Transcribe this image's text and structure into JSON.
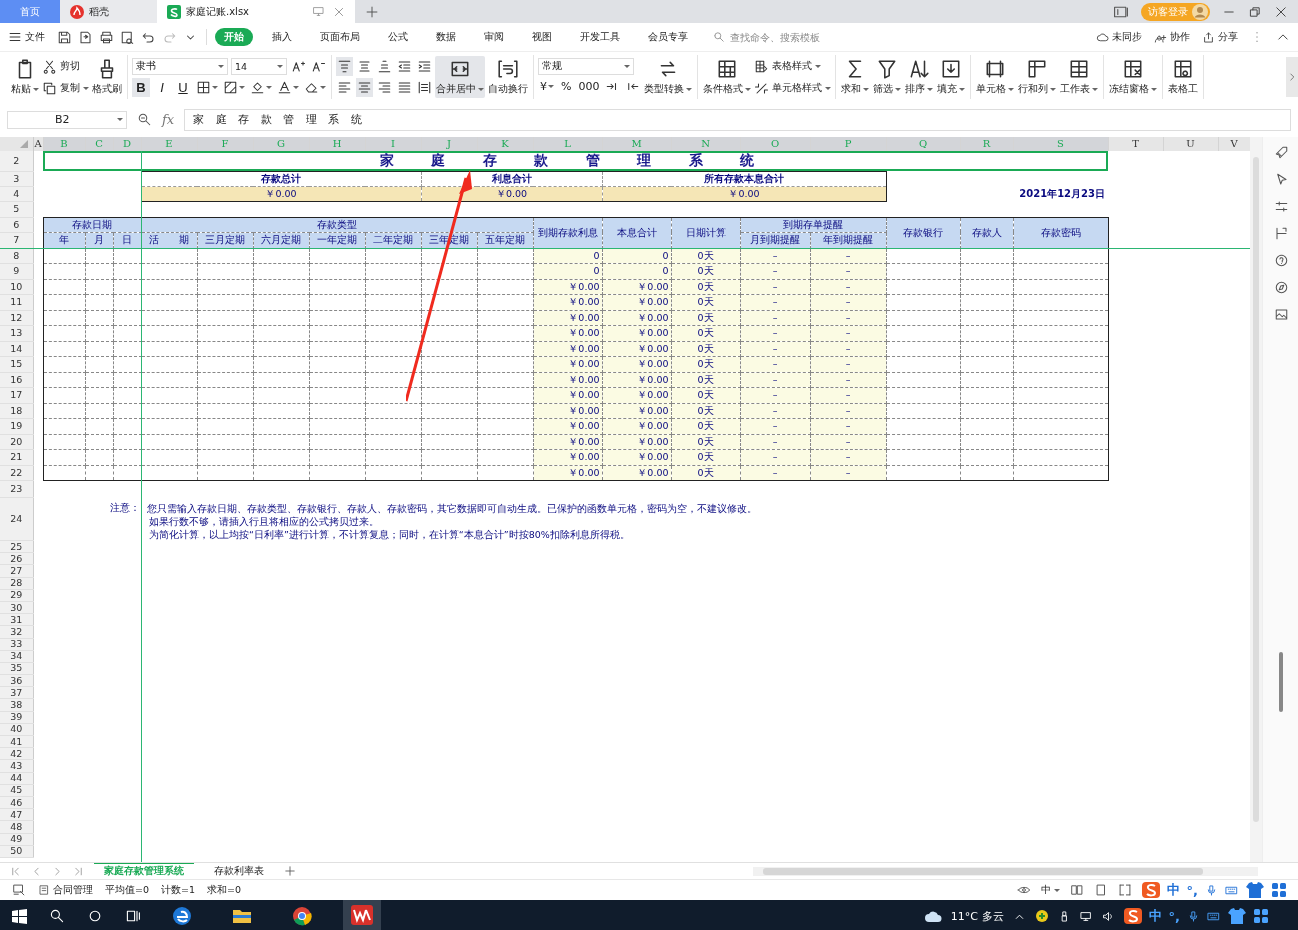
{
  "app_tabs": [
    {
      "label": "首页",
      "kind": "home",
      "selected": false
    },
    {
      "label": "稻壳",
      "kind": "docer",
      "selected": false
    },
    {
      "label": "家庭记账.xlsx",
      "kind": "file",
      "selected": true
    }
  ],
  "login": "访客登录",
  "menu": {
    "file": "文件",
    "tabs": [
      {
        "label": "开始",
        "selected": true
      },
      {
        "label": "插入",
        "selected": false
      },
      {
        "label": "页面布局",
        "selected": false
      },
      {
        "label": "公式",
        "selected": false
      },
      {
        "label": "数据",
        "selected": false
      },
      {
        "label": "审阅",
        "selected": false
      },
      {
        "label": "视图",
        "selected": false
      },
      {
        "label": "开发工具",
        "selected": false
      },
      {
        "label": "会员专享",
        "selected": false
      }
    ],
    "search": {
      "placeholder": "查找命令、搜索模板"
    },
    "actions": [
      "未同步",
      "协作",
      "分享"
    ]
  },
  "ribbon": [
    [
      {
        "kind": "large",
        "label": "粘贴",
        "dropdown": true
      },
      {
        "kind": "stack",
        "rows": [
          [
            {
              "kind": "small",
              "label": "剪切",
              "dropdown": false
            }
          ],
          [
            {
              "kind": "small",
              "label": "复制",
              "dropdown": true
            }
          ]
        ]
      },
      {
        "kind": "large",
        "label": "格式刷",
        "dropdown": false
      }
    ],
    [
      {
        "kind": "stack",
        "rows": [
          [
            {
              "kind": "field",
              "value": "隶书"
            },
            {
              "kind": "field",
              "value": "14"
            },
            {
              "kind": "icon",
              "selected": false,
              "dropdown": false
            },
            {
              "kind": "icon",
              "selected": false,
              "dropdown": false
            }
          ],
          [
            {
              "kind": "toggle",
              "label": "B",
              "selected": true
            },
            {
              "kind": "toggle",
              "label": "I",
              "selected": false
            },
            {
              "kind": "toggle",
              "label": "U",
              "selected": false
            },
            {
              "kind": "icon",
              "selected": false,
              "dropdown": true
            },
            {
              "kind": "icon",
              "selected": false,
              "dropdown": true
            },
            {
              "kind": "icon",
              "selected": false,
              "dropdown": true
            },
            {
              "kind": "icon",
              "selected": false,
              "dropdown": true
            },
            {
              "kind": "icon",
              "selected": false,
              "dropdown": true
            }
          ]
        ]
      }
    ],
    [
      {
        "kind": "stack",
        "rows": [
          [
            {
              "kind": "icon",
              "selected": true,
              "dropdown": false
            },
            {
              "kind": "icon",
              "selected": false,
              "dropdown": false
            },
            {
              "kind": "icon",
              "selected": false,
              "dropdown": false
            },
            {
              "kind": "icon",
              "selected": false,
              "dropdown": false
            },
            {
              "kind": "icon",
              "selected": false,
              "dropdown": false
            }
          ],
          [
            {
              "kind": "icon",
              "selected": false,
              "dropdown": false
            },
            {
              "kind": "icon",
              "selected": true,
              "dropdown": false
            },
            {
              "kind": "icon",
              "selected": false,
              "dropdown": false
            },
            {
              "kind": "icon",
              "selected": false,
              "dropdown": false
            },
            {
              "kind": "icon",
              "selected": false,
              "dropdown": false
            }
          ]
        ]
      },
      {
        "kind": "large",
        "label": "合并居中",
        "dropdown": true,
        "selected": true
      },
      {
        "kind": "large",
        "label": "自动换行",
        "dropdown": false,
        "selected": false
      }
    ],
    [
      {
        "kind": "stack",
        "rows": [
          [
            {
              "kind": "field",
              "value": "常规"
            }
          ],
          [
            {
              "kind": "glyph",
              "label": "¥",
              "dropdown": true
            },
            {
              "kind": "glyph",
              "label": "%",
              "dropdown": false
            },
            {
              "kind": "glyph",
              "label": "000",
              "dropdown": false
            },
            {
              "kind": "icon",
              "selected": false,
              "dropdown": false
            },
            {
              "kind": "icon",
              "selected": false,
              "dropdown": false
            }
          ]
        ]
      },
      {
        "kind": "large",
        "label": "类型转换",
        "dropdown": true
      }
    ],
    [
      {
        "kind": "large",
        "label": "条件格式",
        "dropdown": true
      },
      {
        "kind": "stack",
        "rows": [
          [
            {
              "kind": "small",
              "label": "表格样式",
              "dropdown": true
            }
          ],
          [
            {
              "kind": "small",
              "label": "单元格样式",
              "dropdown": true
            }
          ]
        ]
      }
    ],
    [
      {
        "kind": "large",
        "label": "求和",
        "dropdown": true
      },
      {
        "kind": "large",
        "label": "筛选",
        "dropdown": true
      },
      {
        "kind": "large",
        "label": "排序",
        "dropdown": true
      },
      {
        "kind": "large",
        "label": "填充",
        "dropdown": true
      }
    ],
    [
      {
        "kind": "large",
        "label": "单元格",
        "dropdown": true
      },
      {
        "kind": "large",
        "label": "行和列",
        "dropdown": true
      },
      {
        "kind": "large",
        "label": "工作表",
        "dropdown": true
      }
    ],
    [
      {
        "kind": "large",
        "label": "冻结窗格",
        "dropdown": true
      }
    ],
    [
      {
        "kind": "large",
        "label": "表格工",
        "dropdown": false
      }
    ]
  ],
  "formula_bar": {
    "name_box": "B2",
    "fx": "fx",
    "formula": "家 庭 存 款 管 理 系 统"
  },
  "sheet": {
    "column_headers": [
      "A",
      "B",
      "C",
      "D",
      "E",
      "F",
      "G",
      "H",
      "I",
      "J",
      "K",
      "L",
      "M",
      "N",
      "O",
      "P",
      "Q",
      "R",
      "S",
      "T",
      "U",
      "V"
    ],
    "row_numbers": [
      "2",
      "3",
      "4",
      "5",
      "6",
      "7",
      "8",
      "9",
      "10",
      "11",
      "12",
      "13",
      "14",
      "15",
      "16",
      "17",
      "18",
      "19",
      "20",
      "21",
      "22",
      "23",
      "24",
      "25",
      "26",
      "27",
      "28",
      "29",
      "30",
      "31",
      "32",
      "33",
      "34",
      "35",
      "36",
      "37",
      "38",
      "39",
      "40",
      "41",
      "42",
      "43",
      "44",
      "45",
      "46",
      "47",
      "48",
      "49",
      "50"
    ],
    "title": "家 庭 存 款 管 理 系 统",
    "summary": [
      {
        "label": "存款总计",
        "value": "￥0.00"
      },
      {
        "label": "利息合计",
        "value": "￥0.00"
      },
      {
        "label": "所有存款本息合计",
        "value": "￥0.00"
      }
    ],
    "date": "2021年12月23日",
    "date_header": {
      "label": "存款日期",
      "sub": [
        "年",
        "月",
        "日"
      ]
    },
    "type_header": {
      "label": "存款类型",
      "sub": [
        "活　　期",
        "三月定期",
        "六月定期",
        "一年定期",
        "二年定期",
        "三年定期",
        "五年定期"
      ]
    },
    "single_headers": [
      "到期存款利息",
      "本息合计",
      "日期计算"
    ],
    "reminder_header": {
      "label": "到期存单提醒",
      "sub": [
        "月到期提醒",
        "年到期提醒"
      ]
    },
    "tail_headers": [
      "存款银行",
      "存款人",
      "存款密码"
    ],
    "data_rows": [
      [
        "0",
        "0",
        "0天",
        "–",
        "–"
      ],
      [
        "0",
        "0",
        "0天",
        "–",
        "–"
      ],
      [
        "￥0.00",
        "￥0.00",
        "0天",
        "–",
        "–"
      ],
      [
        "￥0.00",
        "￥0.00",
        "0天",
        "–",
        "–"
      ],
      [
        "￥0.00",
        "￥0.00",
        "0天",
        "–",
        "–"
      ],
      [
        "￥0.00",
        "￥0.00",
        "0天",
        "–",
        "–"
      ],
      [
        "￥0.00",
        "￥0.00",
        "0天",
        "–",
        "–"
      ],
      [
        "￥0.00",
        "￥0.00",
        "0天",
        "–",
        "–"
      ],
      [
        "￥0.00",
        "￥0.00",
        "0天",
        "–",
        "–"
      ],
      [
        "￥0.00",
        "￥0.00",
        "0天",
        "–",
        "–"
      ],
      [
        "￥0.00",
        "￥0.00",
        "0天",
        "–",
        "–"
      ],
      [
        "￥0.00",
        "￥0.00",
        "0天",
        "–",
        "–"
      ],
      [
        "￥0.00",
        "￥0.00",
        "0天",
        "–",
        "–"
      ],
      [
        "￥0.00",
        "￥0.00",
        "0天",
        "–",
        "–"
      ],
      [
        "￥0.00",
        "￥0.00",
        "0天",
        "–",
        "–"
      ]
    ],
    "note_label": "注意：",
    "notes": [
      "您只需输入存款日期、存款类型、存款银行、存款人、存款密码，其它数据即可自动生成。已保护的函数单元格，密码为空，不建议修改。",
      "如果行数不够，请插入行且将相应的公式拷贝过来。",
      "为简化计算，以上均按“日利率”进行计算，不计算复息；同时，在计算“本息合计”时按80%扣除利息所得税。"
    ]
  },
  "sheet_tabs": [
    {
      "label": "家庭存款管理系统",
      "selected": true
    },
    {
      "label": "存款利率表",
      "selected": false
    }
  ],
  "status_bar": {
    "items": [
      "合同管理"
    ],
    "stats": [
      "平均值=0",
      "计数=1",
      "求和=0"
    ],
    "input": "中"
  },
  "ime": {
    "label": "中",
    "punct": "°,"
  },
  "taskbar": {
    "apps": [
      {
        "kind": "edge",
        "active": false
      },
      {
        "kind": "explorer",
        "active": false
      },
      {
        "kind": "chrome",
        "active": false
      },
      {
        "kind": "wps",
        "active": true
      }
    ],
    "weather": "11°C 多云",
    "input": "中"
  }
}
